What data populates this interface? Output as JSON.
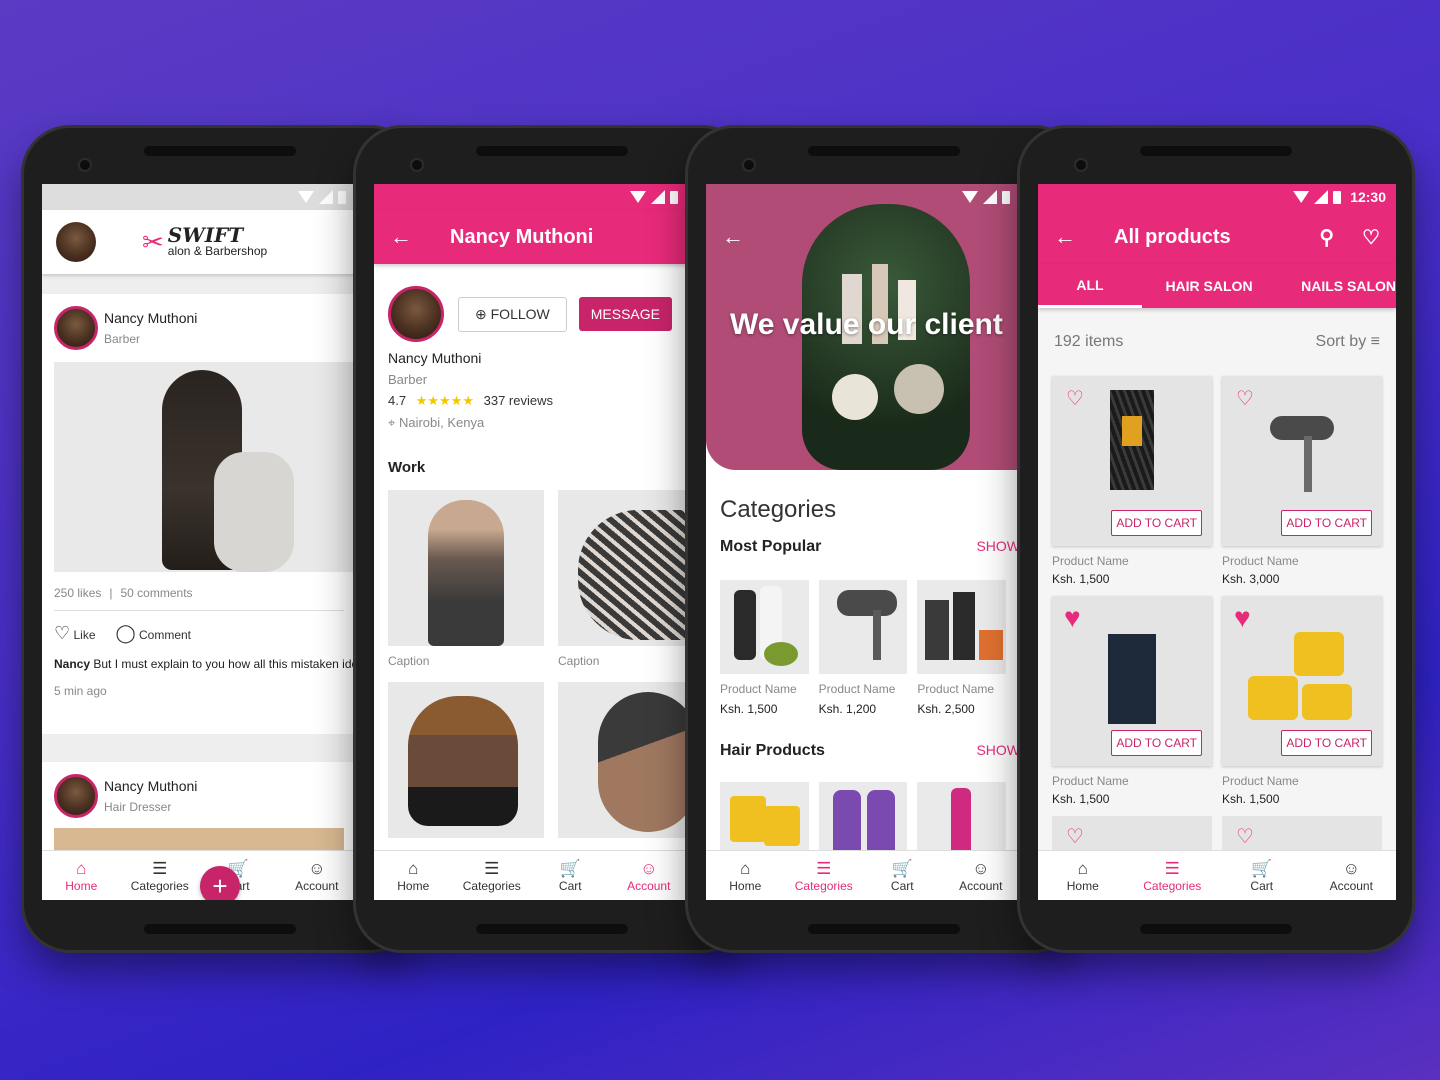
{
  "phone1": {
    "brand": {
      "name": "SWIFT",
      "tagline": "alon & Barbershop"
    },
    "posts": [
      {
        "author": "Nancy Muthoni",
        "role": "Barber",
        "likes": "250 likes",
        "comments": "50 comments",
        "like_label": "Like",
        "comment_label": "Comment",
        "caption_author": "Nancy",
        "caption_text": " But I must explain to you how all this mistaken idea of denouncing pleasure and praising pain",
        "time": "5 min ago"
      },
      {
        "author": "Nancy Muthoni",
        "role": "Hair Dresser"
      }
    ],
    "fab": "+",
    "nav": [
      "Home",
      "Categories",
      "Cart",
      "Account"
    ]
  },
  "phone2": {
    "title": "Nancy Muthoni",
    "follow_label": "FOLLOW",
    "message_label": "MESSAGE",
    "name": "Nancy Muthoni",
    "role": "Barber",
    "rating": "4.7",
    "stars": "★★★★★",
    "reviews": "337 reviews",
    "location": "Nairobi, Kenya",
    "work_heading": "Work",
    "captions": [
      "Caption",
      "Caption"
    ],
    "nav": [
      "Home",
      "Categories",
      "Cart",
      "Account"
    ]
  },
  "phone3": {
    "hero_text": "We value our client",
    "categories_heading": "Categories",
    "sections": [
      {
        "title": "Most Popular",
        "show": "SHOW"
      },
      {
        "title": "Hair Products",
        "show": "SHOW"
      }
    ],
    "products": [
      {
        "name": "Product Name",
        "price": "Ksh. 1,500"
      },
      {
        "name": "Product Name",
        "price": "Ksh. 1,200"
      },
      {
        "name": "Product Name",
        "price": "Ksh. 2,500"
      }
    ],
    "nav": [
      "Home",
      "Categories",
      "Cart",
      "Account"
    ]
  },
  "phone4": {
    "time": "12:30",
    "title": "All products",
    "tabs": [
      "ALL",
      "HAIR SALON",
      "NAILS SALON"
    ],
    "count": "192 items",
    "sort_label": "Sort by",
    "add_label": "ADD TO CART",
    "products": [
      {
        "name": "Product Name",
        "price": "Ksh. 1,500"
      },
      {
        "name": "Product Name",
        "price": "Ksh. 3,000"
      },
      {
        "name": "Product Name",
        "price": "Ksh. 1,500"
      },
      {
        "name": "Product Name",
        "price": "Ksh. 1,500"
      }
    ],
    "nav": [
      "Home",
      "Categories",
      "Cart",
      "Account"
    ]
  },
  "colors": {
    "accent": "#e82a7a",
    "accent_dark": "#c8246a"
  },
  "icons": [
    "back-arrow-icon",
    "search-icon",
    "heart-icon",
    "home-icon",
    "categories-icon",
    "cart-icon",
    "account-icon",
    "location-pin-icon",
    "plus-icon",
    "sort-icon",
    "wifi-icon",
    "signal-icon",
    "battery-icon"
  ]
}
